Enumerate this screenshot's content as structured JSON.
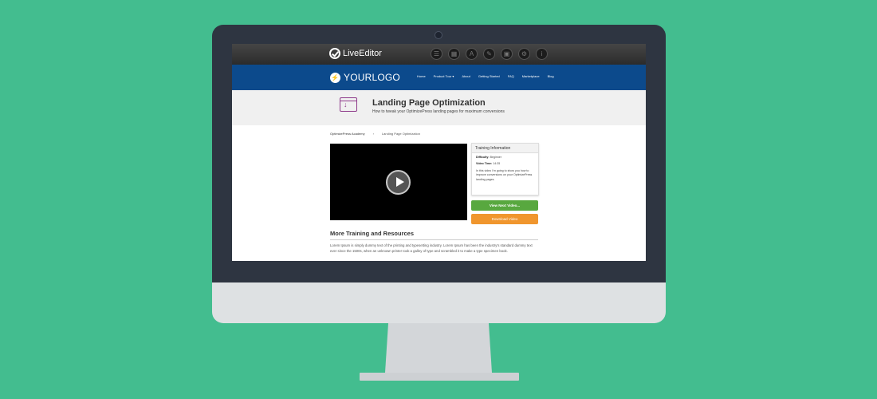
{
  "editor": {
    "logo_text": "LiveEditor",
    "icons": [
      "list-icon",
      "layout-icon",
      "text-icon",
      "pencil-icon",
      "save-icon",
      "settings-icon",
      "info-icon"
    ],
    "icon_glyphs": [
      "☰",
      "▦",
      "A",
      "✎",
      "▣",
      "⚙",
      "i"
    ]
  },
  "site": {
    "logo_text": "YOURLOGO",
    "nav": [
      "Home",
      "Product Tour ▾",
      "About",
      "Getting Started",
      "FAQ",
      "Marketplace",
      "Blog"
    ]
  },
  "header": {
    "title": "Landing Page Optimization",
    "subtitle": "How to tweak your OptimizePress landing pages for maximum conversions"
  },
  "breadcrumb": [
    "OptimizePress Academy",
    "›",
    "Landing Page Optimization"
  ],
  "training": {
    "title": "Training Information",
    "difficulty_label": "Difficulty:",
    "difficulty_value": "Beginner",
    "video_time_label": "Video Time:",
    "video_time_value": "14:35",
    "description": "In this video I'm going to show you how to improve conversions on your OptimizePress landing pages."
  },
  "buttons": {
    "next": "View Next Video...",
    "download": "Download Video"
  },
  "more": {
    "title": "More Training and Resources",
    "text": "Lorem Ipsum is simply dummy text of the printing and typesetting industry. Lorem Ipsum has been the industry's standard dummy text ever since the 1500s, when an unknown printer took a galley of type and scrambled it to make a type specimen book."
  },
  "colors": {
    "background": "#43bd8f",
    "nav": "#0c4a8c",
    "next_button": "#58a83f",
    "download_button": "#f0962e"
  }
}
